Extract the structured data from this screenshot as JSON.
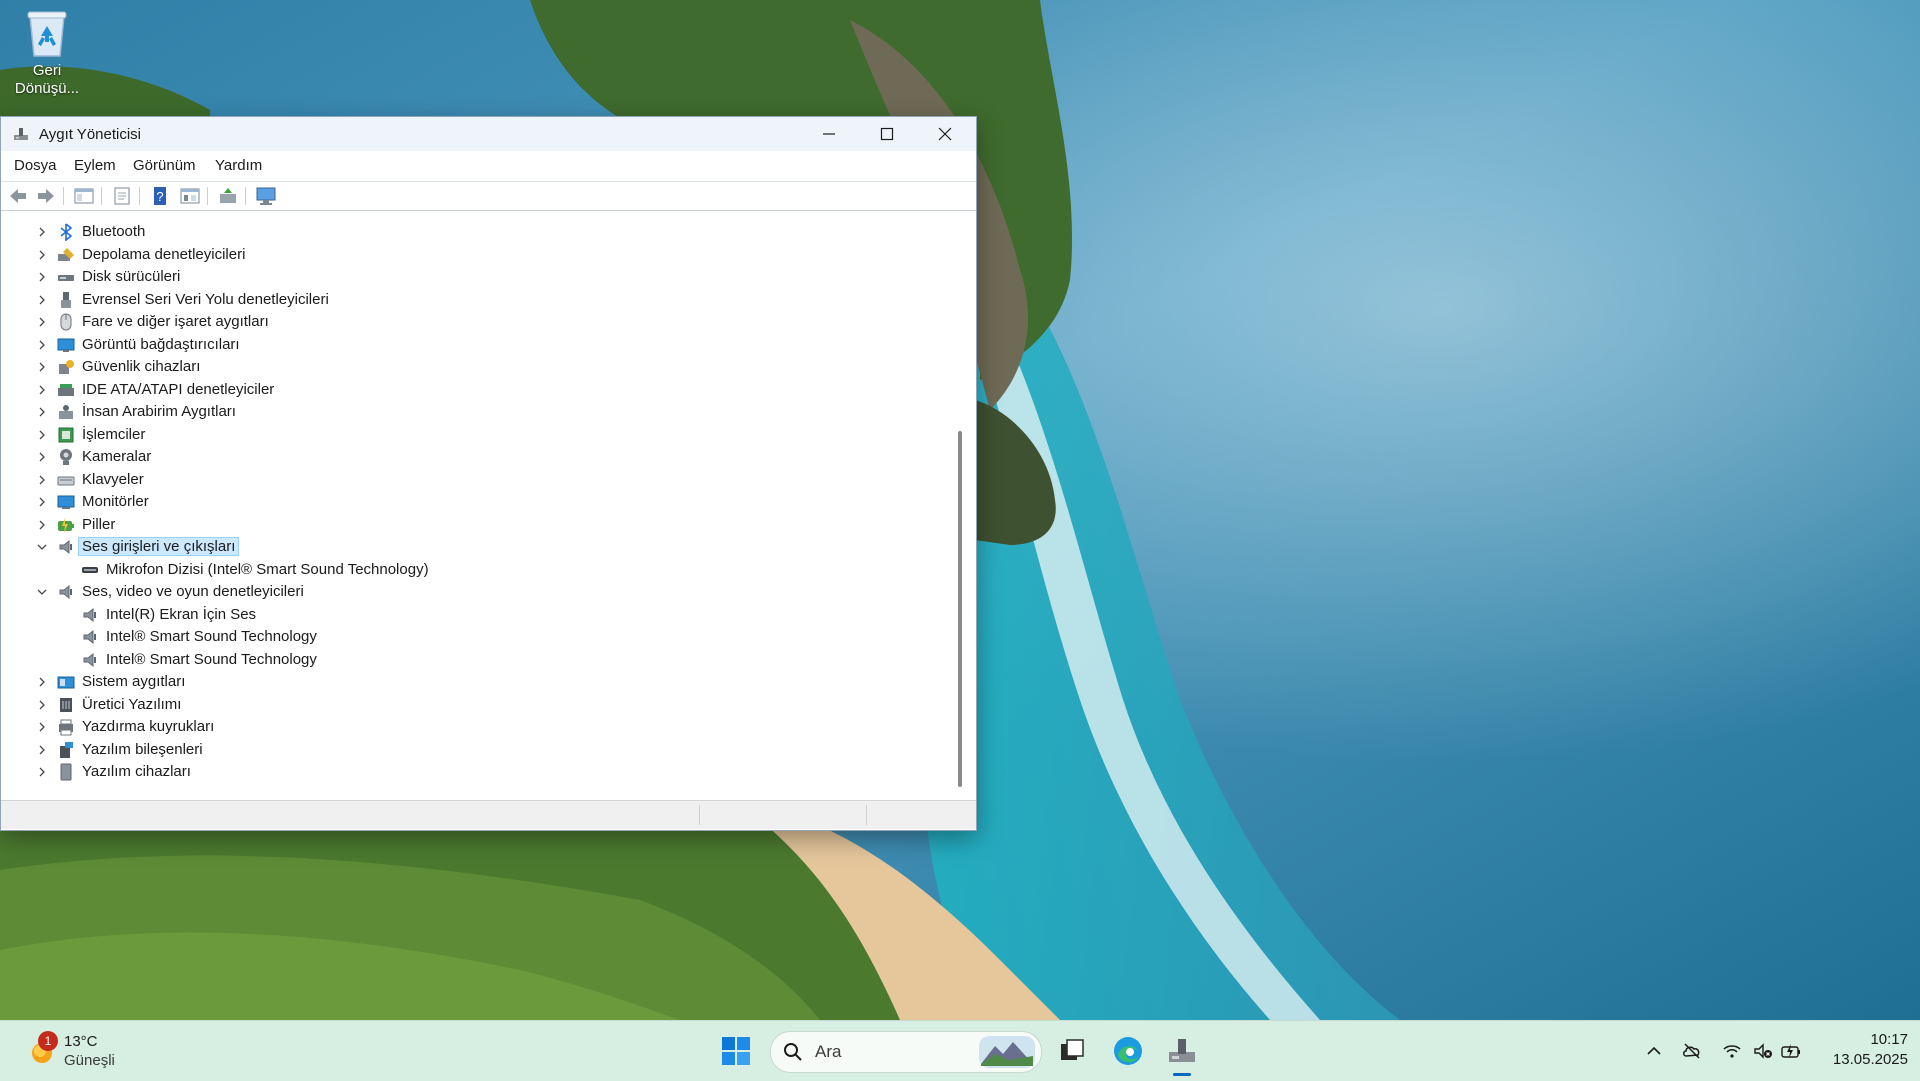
{
  "desktop": {
    "recycle_bin_label": "Geri Dönüşü..."
  },
  "window": {
    "title": "Aygıt Yöneticisi",
    "menu": [
      "Dosya",
      "Eylem",
      "Görünüm",
      "Yardım"
    ],
    "tree": [
      {
        "label": "Bluetooth",
        "icon": "bluetooth-icon",
        "expanded": false,
        "level": 0
      },
      {
        "label": "Depolama denetleyicileri",
        "icon": "storage-controller-icon",
        "expanded": false,
        "level": 0
      },
      {
        "label": "Disk sürücüleri",
        "icon": "disk-drive-icon",
        "expanded": false,
        "level": 0
      },
      {
        "label": "Evrensel Seri Veri Yolu denetleyicileri",
        "icon": "usb-icon",
        "expanded": false,
        "level": 0
      },
      {
        "label": "Fare ve diğer işaret aygıtları",
        "icon": "mouse-icon",
        "expanded": false,
        "level": 0
      },
      {
        "label": "Görüntü bağdaştırıcıları",
        "icon": "display-adapter-icon",
        "expanded": false,
        "level": 0
      },
      {
        "label": "Güvenlik cihazları",
        "icon": "security-device-icon",
        "expanded": false,
        "level": 0
      },
      {
        "label": "IDE ATA/ATAPI denetleyiciler",
        "icon": "ide-controller-icon",
        "expanded": false,
        "level": 0
      },
      {
        "label": "İnsan Arabirim Aygıtları",
        "icon": "hid-icon",
        "expanded": false,
        "level": 0
      },
      {
        "label": "İşlemciler",
        "icon": "processor-icon",
        "expanded": false,
        "level": 0
      },
      {
        "label": "Kameralar",
        "icon": "camera-icon",
        "expanded": false,
        "level": 0
      },
      {
        "label": "Klavyeler",
        "icon": "keyboard-icon",
        "expanded": false,
        "level": 0
      },
      {
        "label": "Monitörler",
        "icon": "monitor-icon",
        "expanded": false,
        "level": 0
      },
      {
        "label": "Piller",
        "icon": "battery-icon",
        "expanded": false,
        "level": 0
      },
      {
        "label": "Ses girişleri ve çıkışları",
        "icon": "speaker-icon",
        "expanded": true,
        "level": 0,
        "selected": true
      },
      {
        "label": "Mikrofon Dizisi (Intel® Smart Sound Technology)",
        "icon": "microphone-icon",
        "level": 1
      },
      {
        "label": "Ses, video ve oyun denetleyicileri",
        "icon": "speaker-icon",
        "expanded": true,
        "level": 0
      },
      {
        "label": "Intel(R) Ekran İçin Ses",
        "icon": "speaker-icon",
        "level": 1
      },
      {
        "label": "Intel® Smart Sound Technology",
        "icon": "speaker-icon",
        "level": 1
      },
      {
        "label": "Intel® Smart Sound Technology",
        "icon": "speaker-icon",
        "level": 1
      },
      {
        "label": "Sistem aygıtları",
        "icon": "system-device-icon",
        "expanded": false,
        "level": 0
      },
      {
        "label": "Üretici Yazılımı",
        "icon": "firmware-icon",
        "expanded": false,
        "level": 0
      },
      {
        "label": "Yazdırma kuyrukları",
        "icon": "printer-icon",
        "expanded": false,
        "level": 0
      },
      {
        "label": "Yazılım bileşenleri",
        "icon": "software-component-icon",
        "expanded": false,
        "level": 0
      },
      {
        "label": "Yazılım cihazları",
        "icon": "software-device-icon",
        "expanded": false,
        "level": 0
      }
    ]
  },
  "taskbar": {
    "weather": {
      "temperature": "13°C",
      "condition": "Güneşli",
      "badge": "1"
    },
    "search_placeholder": "Ara",
    "clock": {
      "time": "10:17",
      "date": "13.05.2025"
    }
  },
  "colors": {
    "accent": "#0067c0",
    "selection": "#cce8ff",
    "taskbar": "#d6efe2"
  }
}
